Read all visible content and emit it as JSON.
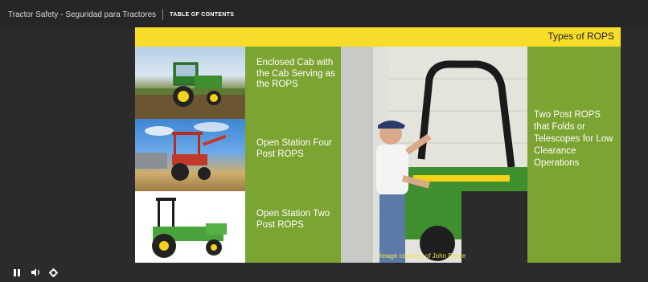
{
  "topbar": {
    "course_title": "Tractor Safety - Seguridad para Tractores",
    "toc_label": "TABLE OF CONTENTS"
  },
  "slide": {
    "title": "Types of ROPS",
    "left_items": [
      {
        "label": "Enclosed Cab with the Cab Serving as the ROPS"
      },
      {
        "label": "Open Station Four Post ROPS"
      },
      {
        "label": "Open Station Two Post ROPS"
      }
    ],
    "right_label": "Two Post ROPS that Folds or Telescopes for Low Clearance Operations",
    "photo_credit": "Image courtesy of John Deere"
  },
  "controls": {
    "icons": [
      "pause-icon",
      "volume-icon",
      "gear-icon"
    ]
  },
  "colors": {
    "slide_green": "#7ba432",
    "header_yellow": "#f8dc2a",
    "tractor_green": "#3f8f2e",
    "tractor_yellow": "#f2d21a",
    "loader_red": "#c0392b"
  }
}
